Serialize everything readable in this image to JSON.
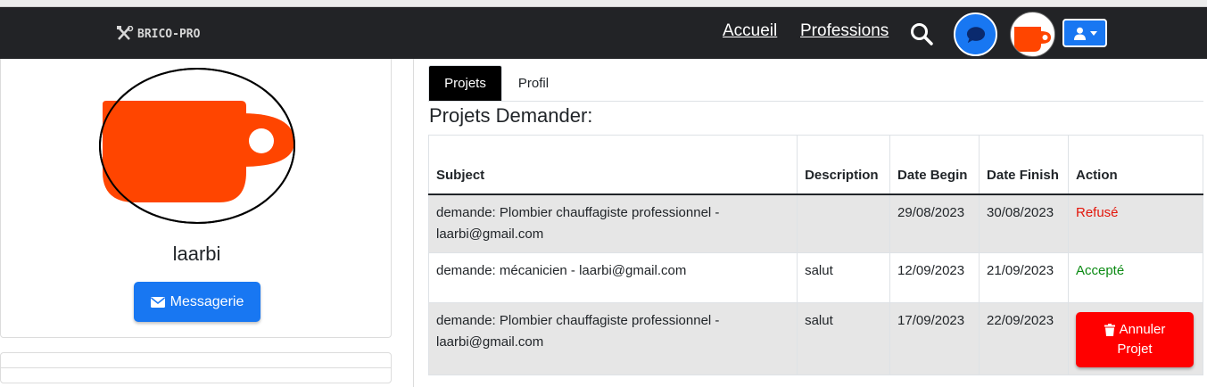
{
  "brand": {
    "name": "BRICO-PRO",
    "icon": "tools-icon"
  },
  "nav": {
    "links": [
      {
        "label": "Accueil"
      },
      {
        "label": "Professions"
      }
    ],
    "search_icon": "search-icon",
    "chat_icon": "chat-bubble-icon",
    "user_menu_icon": "user-icon"
  },
  "profile": {
    "username": "laarbi",
    "message_button_label": "Messagerie",
    "message_icon": "envelope-icon"
  },
  "tabs": [
    {
      "label": "Projets",
      "active": true
    },
    {
      "label": "Profil",
      "active": false
    }
  ],
  "section_title": "Projets Demander:",
  "table": {
    "headers": {
      "subject": "Subject",
      "description": "Description",
      "date_begin": "Date Begin",
      "date_finish": "Date Finish",
      "action": "Action"
    },
    "rows": [
      {
        "subject": "demande: Plombier chauffagiste professionnel - laarbi@gmail.com",
        "description": "",
        "date_begin": "29/08/2023",
        "date_finish": "30/08/2023",
        "action": "Refusé"
      },
      {
        "subject": "demande: mécanicien - laarbi@gmail.com",
        "description": "salut",
        "date_begin": "12/09/2023",
        "date_finish": "21/09/2023",
        "action": "Accepté"
      },
      {
        "subject": "demande: Plombier chauffagiste professionnel - laarbi@gmail.com",
        "description": "salut",
        "date_begin": "17/09/2023",
        "date_finish": "22/09/2023",
        "action_button": {
          "line1": "Annuler",
          "line2": "Projet",
          "icon": "trash-icon"
        }
      }
    ]
  },
  "colors": {
    "navbar": "#222326",
    "primary": "#1877f2",
    "avatar_cup": "#ff4500",
    "danger": "#ff0000",
    "refused": "#e3160b",
    "accepted": "#0b8a13"
  }
}
